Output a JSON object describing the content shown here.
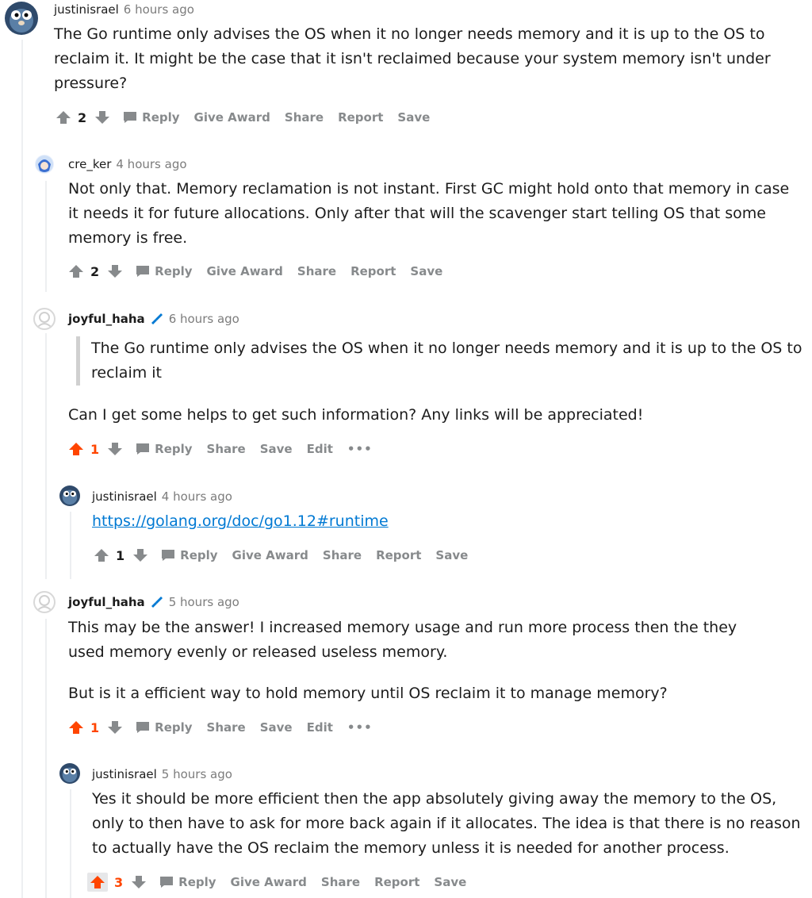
{
  "comments": [
    {
      "user": "justinisrael",
      "time": "6 hours ago",
      "avatar": "gopher-avatar",
      "body": [
        "The Go runtime only advises the OS when it no longer needs memory and it is up to the OS to",
        "reclaim it. It might be the case that it isn't reclaimed because your system memory isn't under",
        "pressure?"
      ],
      "score": "2",
      "actions": [
        "Reply",
        "Give Award",
        "Share",
        "Report",
        "Save"
      ]
    },
    {
      "user": "cre_ker",
      "time": "4 hours ago",
      "avatar": "anime-avatar",
      "body": [
        "Not only that. Memory reclamation is not instant. First GC might hold onto that memory in case",
        "it needs it for future allocations. Only after that will the scavenger start telling OS that some",
        "memory is free."
      ],
      "score": "2",
      "actions": [
        "Reply",
        "Give Award",
        "Share",
        "Report",
        "Save"
      ]
    },
    {
      "user": "joyful_haha",
      "time": "6 hours ago",
      "avatar": "default-avatar",
      "quote": [
        "The Go runtime only advises the OS when it no longer needs memory and it is up to the OS to",
        "reclaim it"
      ],
      "body": [
        "Can I get some helps to get such information? Any links will be appreciated!"
      ],
      "score": "1",
      "actions": [
        "Reply",
        "Share",
        "Save",
        "Edit",
        "•••"
      ]
    },
    {
      "user": "justinisrael",
      "time": "4 hours ago",
      "avatar": "gopher-avatar",
      "link": "https://golang.org/doc/go1.12#runtime",
      "score": "1",
      "actions": [
        "Reply",
        "Give Award",
        "Share",
        "Report",
        "Save"
      ]
    },
    {
      "user": "joyful_haha",
      "time": "5 hours ago",
      "avatar": "default-avatar",
      "body": [
        "This may be the answer! I increased memory usage and run more process then the they",
        "used memory evenly or released useless memory."
      ],
      "body2": [
        "But is it a efficient way to hold memory until OS reclaim it to manage memory?"
      ],
      "score": "1",
      "actions": [
        "Reply",
        "Share",
        "Save",
        "Edit",
        "•••"
      ]
    },
    {
      "user": "justinisrael",
      "time": "5 hours ago",
      "avatar": "gopher-avatar",
      "body": [
        "Yes it should be more efficient then the app absolutely giving away the memory to the OS,",
        "only to then have to ask for more back again if it allocates. The idea is that there is no reason",
        "to actually have the OS reclaim the memory unless it is needed for another process."
      ],
      "score": "3",
      "actions": [
        "Reply",
        "Give Award",
        "Share",
        "Report",
        "Save"
      ]
    }
  ],
  "colors": {
    "upvoted": "#ff4500",
    "muted": "#878a8c",
    "link": "#0079d3"
  }
}
